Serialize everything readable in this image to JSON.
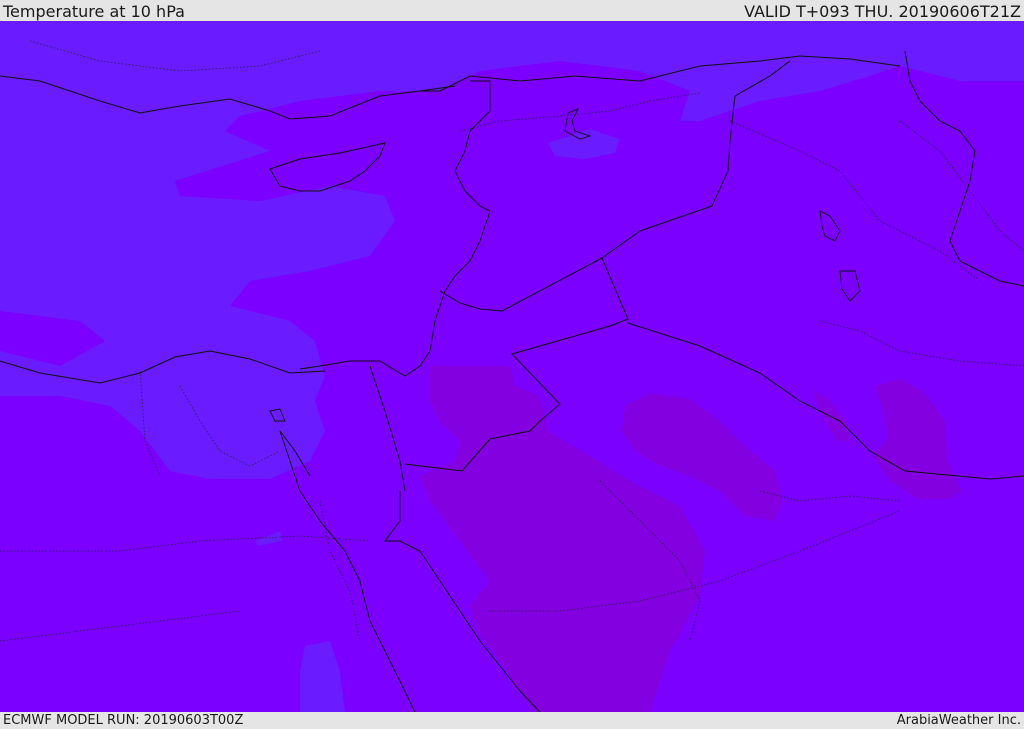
{
  "header": {
    "title": "Temperature at 10 hPa",
    "valid": "VALID T+093 THU. 20190606T21Z"
  },
  "footer": {
    "model_run": "ECMWF MODEL RUN: 20190603T00Z",
    "credit": "ArabiaWeather Inc."
  },
  "map": {
    "field": "temperature",
    "level": "10 hPa",
    "colors": {
      "base": "#7b00ff",
      "cooler": "#6a1bff",
      "warmer": "#8300e0",
      "coast": "#111111",
      "borders": "#222244"
    }
  }
}
